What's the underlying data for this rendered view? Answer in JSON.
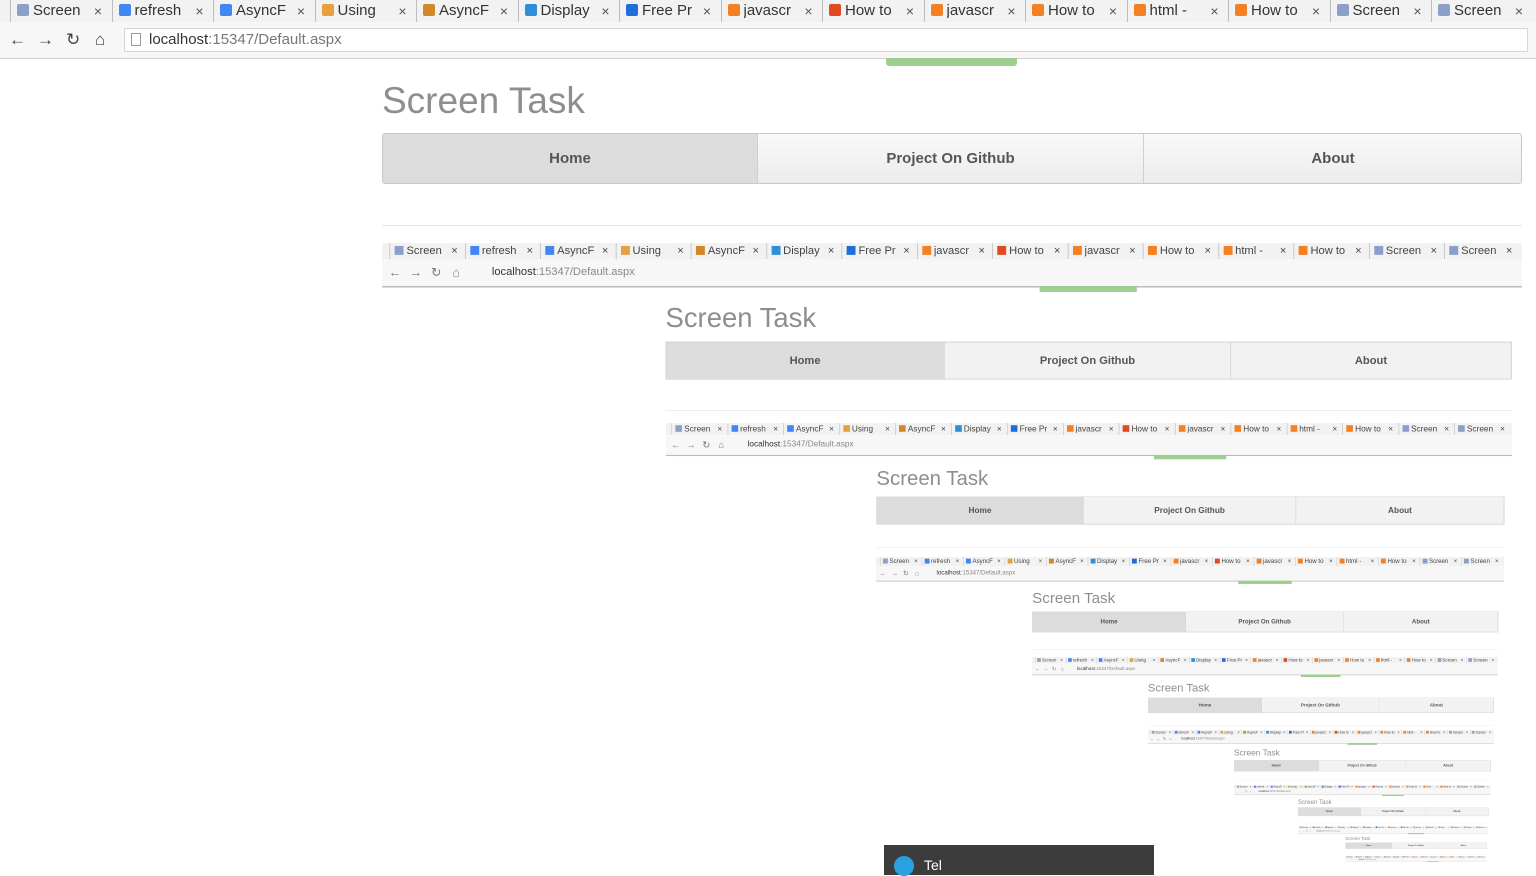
{
  "browser": {
    "tabs": [
      {
        "label": "Screen",
        "icon": "page-icon",
        "color": "#8aa0c8"
      },
      {
        "label": "refresh",
        "icon": "google-icon",
        "color": "#4285f4"
      },
      {
        "label": "AsyncF",
        "icon": "google-icon",
        "color": "#4285f4"
      },
      {
        "label": "Using",
        "icon": "site-icon",
        "color": "#e6a040"
      },
      {
        "label": "AsyncF",
        "icon": "site-icon",
        "color": "#d2872a"
      },
      {
        "label": "Display",
        "icon": "asp-icon",
        "color": "#2d8fd5"
      },
      {
        "label": "Free Pr",
        "icon": "site-icon",
        "color": "#1e6fd9"
      },
      {
        "label": "javascr",
        "icon": "stackoverflow-icon",
        "color": "#f48024"
      },
      {
        "label": "How to",
        "icon": "windows-icon",
        "color": "#e04a1e"
      },
      {
        "label": "javascr",
        "icon": "stackoverflow-icon",
        "color": "#f48024"
      },
      {
        "label": "How to",
        "icon": "stackoverflow-icon",
        "color": "#f48024"
      },
      {
        "label": "html -",
        "icon": "stackoverflow-icon",
        "color": "#f48024"
      },
      {
        "label": "How to",
        "icon": "stackoverflow-icon",
        "color": "#f48024"
      },
      {
        "label": "Screen",
        "icon": "page-icon",
        "color": "#8aa0c8"
      },
      {
        "label": "Screen",
        "icon": "page-icon",
        "color": "#8aa0c8"
      }
    ],
    "close_glyph": "×",
    "url_host": "localhost",
    "url_path": ":15347/Default.aspx"
  },
  "page": {
    "title": "Screen Task",
    "menu": [
      {
        "label": "Home",
        "active": true
      },
      {
        "label": "Project On Github",
        "active": false
      },
      {
        "label": "About",
        "active": false
      }
    ]
  },
  "notification": {
    "label": "Tel"
  }
}
